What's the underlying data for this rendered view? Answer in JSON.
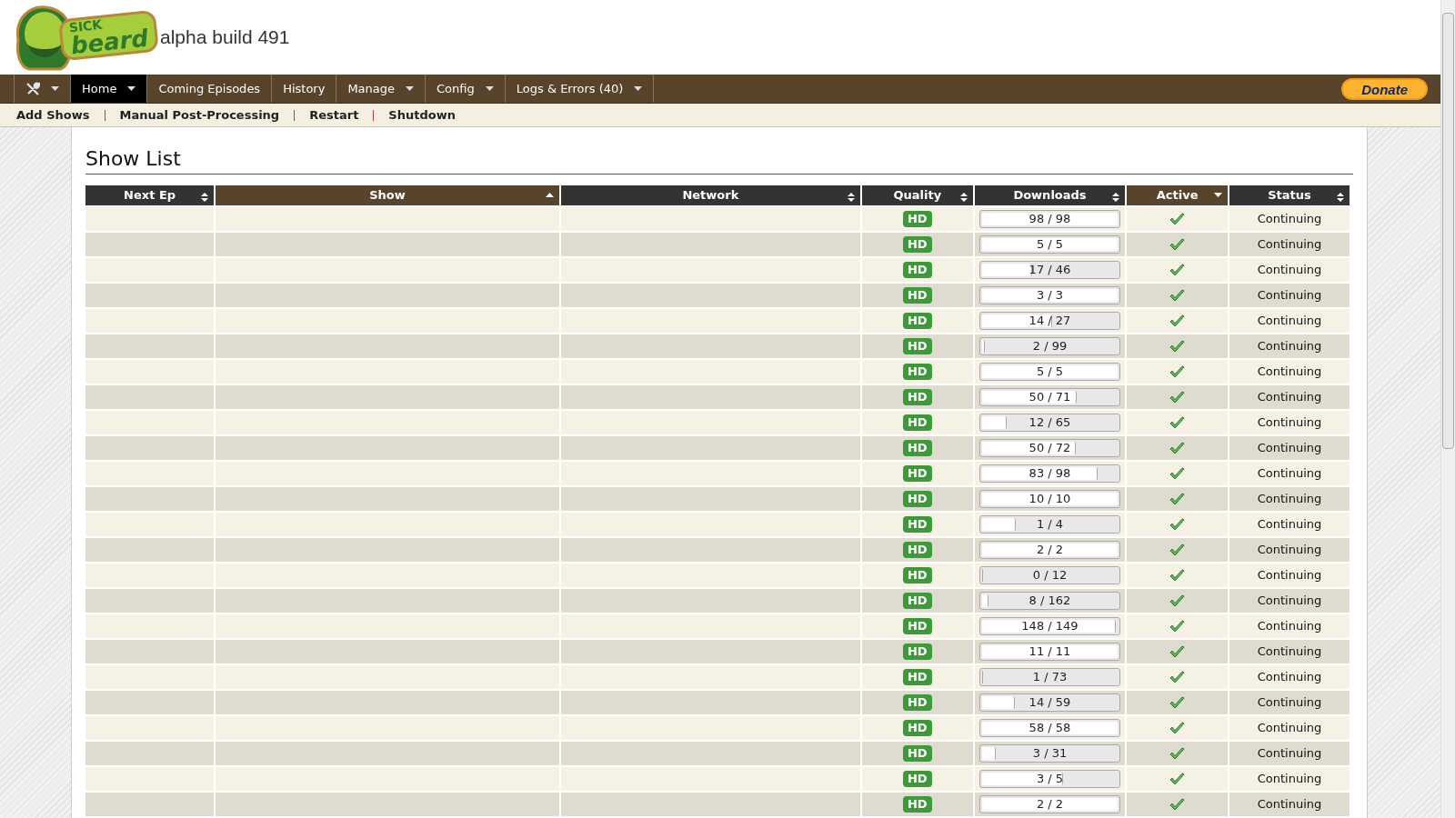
{
  "logo": {
    "top": "SICK",
    "bottom": "beard"
  },
  "version": "alpha build 491",
  "nav": [
    {
      "kind": "icon",
      "selected": false,
      "dropdown": true
    },
    {
      "kind": "text",
      "label": "Home",
      "selected": true,
      "dropdown": true
    },
    {
      "kind": "text",
      "label": "Coming Episodes",
      "selected": false,
      "dropdown": false
    },
    {
      "kind": "text",
      "label": "History",
      "selected": false,
      "dropdown": false
    },
    {
      "kind": "text",
      "label": "Manage",
      "selected": false,
      "dropdown": true
    },
    {
      "kind": "text",
      "label": "Config",
      "selected": false,
      "dropdown": true
    },
    {
      "kind": "text",
      "label": "Logs & Errors (40)",
      "selected": false,
      "dropdown": true
    }
  ],
  "donate": "Donate",
  "subnav": [
    "Add Shows",
    "Manual Post-Processing",
    "Restart",
    "Shutdown"
  ],
  "heading": "Show List",
  "columns": [
    {
      "label": "Next Ep",
      "kind": "unsorted"
    },
    {
      "label": "Show",
      "kind": "ascending"
    },
    {
      "label": "Network",
      "kind": "unsorted"
    },
    {
      "label": "Quality",
      "kind": "unsorted"
    },
    {
      "label": "Downloads",
      "kind": "unsorted"
    },
    {
      "label": "Active",
      "kind": "descending"
    },
    {
      "label": "Status",
      "kind": "unsorted"
    }
  ],
  "rows": [
    {
      "quality": "HD",
      "downloads": "98 / 98",
      "level": 1,
      "active": true,
      "status": "Continuing"
    },
    {
      "quality": "HD",
      "downloads": "5 / 5",
      "level": 1,
      "active": true,
      "status": "Continuing"
    },
    {
      "quality": "HD",
      "downloads": "17 / 46",
      "level": 0.37,
      "active": true,
      "status": "Continuing"
    },
    {
      "quality": "HD",
      "downloads": "3 / 3",
      "level": 1,
      "active": true,
      "status": "Continuing"
    },
    {
      "quality": "HD",
      "downloads": "14 / 27",
      "level": 0.52,
      "active": true,
      "status": "Continuing"
    },
    {
      "quality": "HD",
      "downloads": "2 / 99",
      "level": 0.02,
      "active": true,
      "status": "Continuing"
    },
    {
      "quality": "HD",
      "downloads": "5 / 5",
      "level": 1,
      "active": true,
      "status": "Continuing"
    },
    {
      "quality": "HD",
      "downloads": "50 / 71",
      "level": 0.7,
      "active": true,
      "status": "Continuing"
    },
    {
      "quality": "HD",
      "downloads": "12 / 65",
      "level": 0.18,
      "active": true,
      "status": "Continuing"
    },
    {
      "quality": "HD",
      "downloads": "50 / 72",
      "level": 0.69,
      "active": true,
      "status": "Continuing"
    },
    {
      "quality": "HD",
      "downloads": "83 / 98",
      "level": 0.85,
      "active": true,
      "status": "Continuing"
    },
    {
      "quality": "HD",
      "downloads": "10 / 10",
      "level": 1,
      "active": true,
      "status": "Continuing"
    },
    {
      "quality": "HD",
      "downloads": "1 / 4",
      "level": 0.25,
      "active": true,
      "status": "Continuing"
    },
    {
      "quality": "HD",
      "downloads": "2 / 2",
      "level": 1,
      "active": true,
      "status": "Continuing"
    },
    {
      "quality": "HD",
      "downloads": "0 / 12",
      "level": 0,
      "active": true,
      "status": "Continuing"
    },
    {
      "quality": "HD",
      "downloads": "8 / 162",
      "level": 0.05,
      "active": true,
      "status": "Continuing"
    },
    {
      "quality": "HD",
      "downloads": "148 / 149",
      "level": 0.99,
      "active": true,
      "status": "Continuing"
    },
    {
      "quality": "HD",
      "downloads": "11 / 11",
      "level": 1,
      "active": true,
      "status": "Continuing"
    },
    {
      "quality": "HD",
      "downloads": "1 / 73",
      "level": 0.01,
      "active": true,
      "status": "Continuing"
    },
    {
      "quality": "HD",
      "downloads": "14 / 59",
      "level": 0.24,
      "active": true,
      "status": "Continuing"
    },
    {
      "quality": "HD",
      "downloads": "58 / 58",
      "level": 1,
      "active": true,
      "status": "Continuing"
    },
    {
      "quality": "HD",
      "downloads": "3 / 31",
      "level": 0.1,
      "active": true,
      "status": "Continuing"
    },
    {
      "quality": "HD",
      "downloads": "3 / 5",
      "level": 0.6,
      "active": true,
      "status": "Continuing"
    },
    {
      "quality": "HD",
      "downloads": "2 / 2",
      "level": 1,
      "active": true,
      "status": "Continuing"
    }
  ]
}
